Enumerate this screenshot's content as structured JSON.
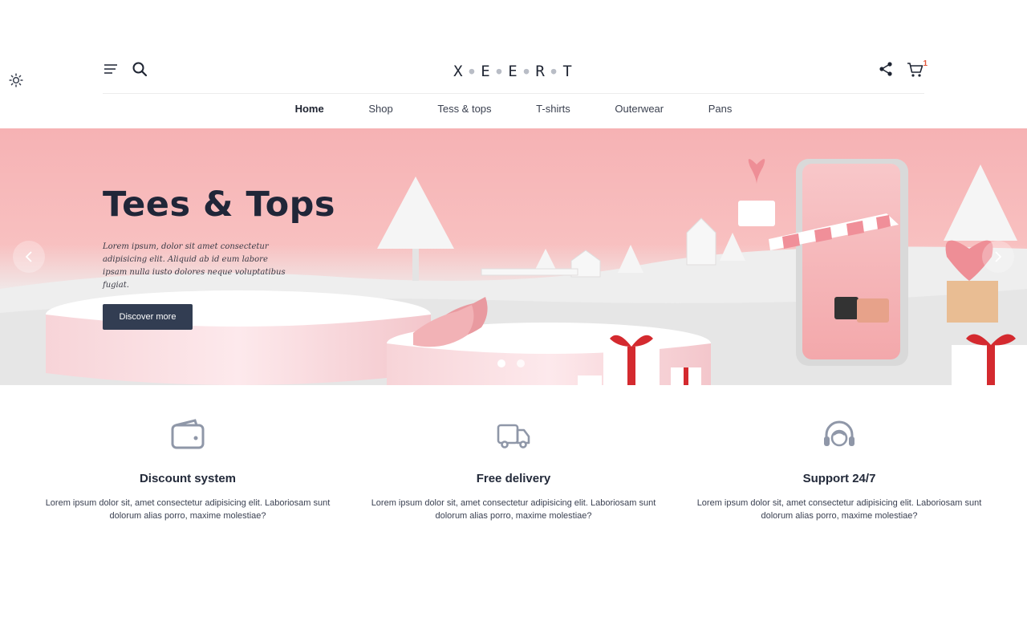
{
  "brand": {
    "letters": [
      "X",
      "E",
      "E",
      "R",
      "T"
    ]
  },
  "header": {
    "cart_count": "1"
  },
  "nav": [
    {
      "label": "Home",
      "active": true
    },
    {
      "label": "Shop",
      "active": false
    },
    {
      "label": "Tess & tops",
      "active": false
    },
    {
      "label": "T-shirts",
      "active": false
    },
    {
      "label": "Outerwear",
      "active": false
    },
    {
      "label": "Pans",
      "active": false
    }
  ],
  "hero": {
    "title": "Tees & Tops",
    "text": "Lorem ipsum, dolor sit amet consectetur adipisicing elit. Aliquid ab id eum labore ipsam nulla iusto dolores neque voluptatibus fugiat.",
    "cta_label": "Discover more",
    "slides": [
      {
        "active": true
      },
      {
        "active": false
      }
    ]
  },
  "features": [
    {
      "icon": "wallet-icon",
      "title": "Discount system",
      "text": "Lorem ipsum dolor sit, amet consectetur adipisicing elit. Laboriosam sunt dolorum alias porro, maxime molestiae?"
    },
    {
      "icon": "truck-icon",
      "title": "Free delivery",
      "text": "Lorem ipsum dolor sit, amet consectetur adipisicing elit. Laboriosam sunt dolorum alias porro, maxime molestiae?"
    },
    {
      "icon": "headset-icon",
      "title": "Support 24/7",
      "text": "Lorem ipsum dolor sit, amet consectetur adipisicing elit. Laboriosam sunt dolorum alias porro, maxime molestiae?"
    }
  ],
  "colors": {
    "accent_dark": "#323d52",
    "cart_badge": "#e2573c",
    "hero_pink": "#f6b2b4",
    "icon_gray": "#8f97a8"
  }
}
